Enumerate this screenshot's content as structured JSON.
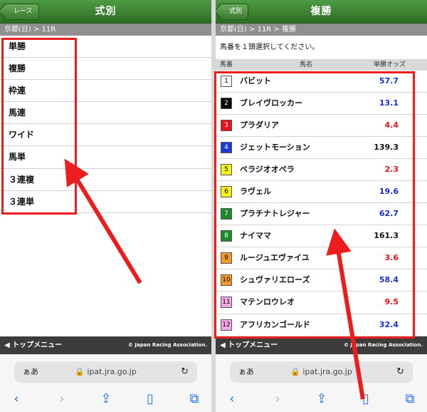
{
  "left": {
    "back_label": "レース",
    "title": "式別",
    "breadcrumb": "京都(日) > 11R",
    "menu": [
      "単勝",
      "複勝",
      "枠連",
      "馬連",
      "ワイド",
      "馬単",
      "３連複",
      "３連単"
    ],
    "footer_top": "トップメニュー",
    "footer_copy": "© Japan Racing Association.",
    "url_aa": "ぁあ",
    "url": "ipat.jra.go.jp"
  },
  "right": {
    "back_label": "式別",
    "title": "複勝",
    "breadcrumb": "京都(日) > 11R > 複勝",
    "instruction": "馬番を１頭選択してください。",
    "headers": {
      "num": "馬番",
      "name": "馬名",
      "odds": "単勝オッズ"
    },
    "horses": [
      {
        "num": "1",
        "name": "バビット",
        "odds": "57.7",
        "frame_bg": "#ffffff",
        "frame_fg": "#000000",
        "odds_color": "#1a2ed0"
      },
      {
        "num": "2",
        "name": "ブレイヴロッカー",
        "odds": "13.1",
        "frame_bg": "#000000",
        "frame_fg": "#ffffff",
        "odds_color": "#1a2ed0"
      },
      {
        "num": "3",
        "name": "プラダリア",
        "odds": "4.4",
        "frame_bg": "#e8101a",
        "frame_fg": "#ffffff",
        "odds_color": "#e8101a"
      },
      {
        "num": "4",
        "name": "ジェットモーション",
        "odds": "139.3",
        "frame_bg": "#1838d8",
        "frame_fg": "#ffffff",
        "odds_color": "#111111"
      },
      {
        "num": "5",
        "name": "ベラジオオペラ",
        "odds": "2.3",
        "frame_bg": "#f5f21a",
        "frame_fg": "#000000",
        "odds_color": "#e8101a"
      },
      {
        "num": "6",
        "name": "ラヴェル",
        "odds": "19.6",
        "frame_bg": "#f5f21a",
        "frame_fg": "#000000",
        "odds_color": "#1a2ed0"
      },
      {
        "num": "7",
        "name": "プラチナトレジャー",
        "odds": "62.7",
        "frame_bg": "#1a8a2a",
        "frame_fg": "#ffffff",
        "odds_color": "#1a2ed0"
      },
      {
        "num": "8",
        "name": "ナイママ",
        "odds": "161.3",
        "frame_bg": "#1a8a2a",
        "frame_fg": "#ffffff",
        "odds_color": "#111111"
      },
      {
        "num": "9",
        "name": "ルージュエヴァイユ",
        "odds": "3.6",
        "frame_bg": "#f39a2a",
        "frame_fg": "#000000",
        "odds_color": "#e8101a"
      },
      {
        "num": "10",
        "name": "シュヴァリエローズ",
        "odds": "58.4",
        "frame_bg": "#f39a2a",
        "frame_fg": "#000000",
        "odds_color": "#1a2ed0"
      },
      {
        "num": "11",
        "name": "マテンロウレオ",
        "odds": "9.5",
        "frame_bg": "#f3a8e8",
        "frame_fg": "#000000",
        "odds_color": "#e8101a"
      },
      {
        "num": "12",
        "name": "アフリカンゴールド",
        "odds": "32.4",
        "frame_bg": "#f3a8e8",
        "frame_fg": "#000000",
        "odds_color": "#1a2ed0"
      }
    ],
    "footer_top": "トップメニュー",
    "footer_copy": "© Japan Racing Association.",
    "url_aa": "ぁあ",
    "url": "ipat.jra.go.jp"
  },
  "colors": {
    "header_green": "#2c6f22",
    "highlight": "#ee1d1d",
    "browser_blue": "#1f6ff2"
  },
  "icons": [
    "back-chevron-icon",
    "forward-chevron-icon",
    "share-icon",
    "bookmarks-icon",
    "tabs-icon",
    "lock-icon",
    "reload-icon",
    "triangle-left-icon"
  ]
}
